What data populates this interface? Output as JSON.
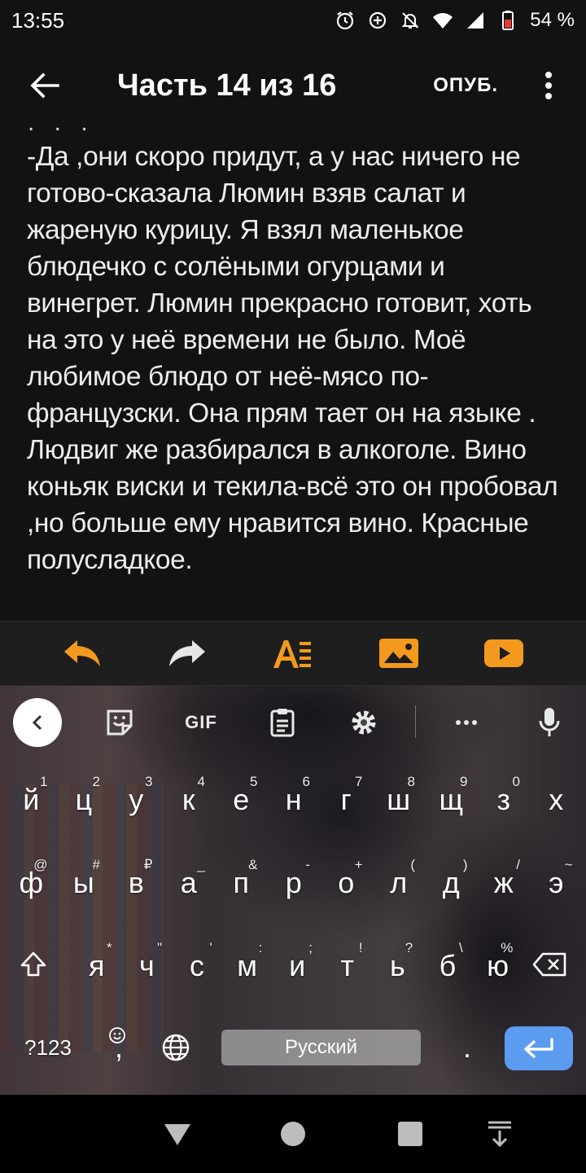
{
  "status_bar": {
    "time": "13:55",
    "battery": "54 %",
    "icons": [
      "alarm-icon",
      "data-saver-icon",
      "notifications-off-icon",
      "wifi-icon",
      "signal-icon",
      "battery-icon"
    ]
  },
  "app_bar": {
    "title": "Часть 14 из 16",
    "publish_label": "ОПУБ."
  },
  "editor": {
    "cut_line": ". . .",
    "text": "-Да ,они скоро придут, а у нас ничего не готово-сказала Люмин взяв салат и жареную курицу. Я взял маленькое блюдечко с солёными огурцами и винегрет. Люмин прекрасно готовит, хоть на это у неё времени не было. Моё любимое блюдо от неё-мясо по-французски. Она прям тает он на языке . Людвиг  же разбирался в алкоголе. Вино коньяк виски и текила-всё это он пробовал ,но больше ему нравится вино. Красные полусладкое."
  },
  "toolbar": {
    "icons": [
      "undo-icon",
      "redo-icon",
      "text-format-icon",
      "insert-image-icon",
      "insert-video-icon"
    ],
    "accent": "#f39a1e"
  },
  "keyboard": {
    "gif_label": "GIF",
    "row1": [
      {
        "k": "й",
        "h": "1"
      },
      {
        "k": "ц",
        "h": "2"
      },
      {
        "k": "у",
        "h": "3"
      },
      {
        "k": "к",
        "h": "4"
      },
      {
        "k": "е",
        "h": "5"
      },
      {
        "k": "н",
        "h": "6"
      },
      {
        "k": "г",
        "h": "7"
      },
      {
        "k": "ш",
        "h": "8"
      },
      {
        "k": "щ",
        "h": "9"
      },
      {
        "k": "з",
        "h": "0"
      },
      {
        "k": "х",
        "h": ""
      }
    ],
    "row2": [
      {
        "k": "ф",
        "h": "@"
      },
      {
        "k": "ы",
        "h": "#"
      },
      {
        "k": "в",
        "h": "₽"
      },
      {
        "k": "а",
        "h": "_"
      },
      {
        "k": "п",
        "h": "&"
      },
      {
        "k": "р",
        "h": "-"
      },
      {
        "k": "о",
        "h": "+"
      },
      {
        "k": "л",
        "h": "("
      },
      {
        "k": "д",
        "h": ")"
      },
      {
        "k": "ж",
        "h": "/"
      },
      {
        "k": "э",
        "h": "~"
      }
    ],
    "row3": [
      {
        "k": "я",
        "h": "*"
      },
      {
        "k": "ч",
        "h": "\""
      },
      {
        "k": "с",
        "h": "'"
      },
      {
        "k": "м",
        "h": ":"
      },
      {
        "k": "и",
        "h": ";"
      },
      {
        "k": "т",
        "h": "!"
      },
      {
        "k": "ь",
        "h": "?"
      },
      {
        "k": "б",
        "h": "\\"
      },
      {
        "k": "ю",
        "h": "%"
      }
    ],
    "symbols_label": "?123",
    "comma_label": ",",
    "space_label": "Русский",
    "period_label": "."
  },
  "nav_bar": {
    "icons": [
      "back-triangle-icon",
      "home-circle-icon",
      "recents-square-icon",
      "hide-keyboard-icon"
    ]
  }
}
